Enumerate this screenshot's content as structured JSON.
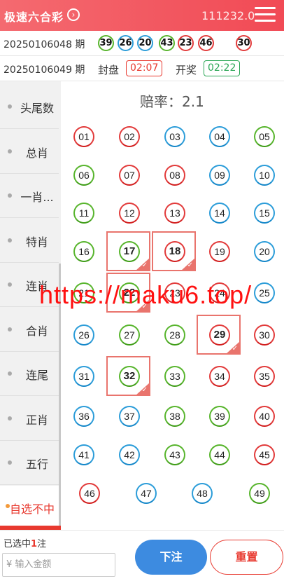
{
  "header": {
    "title": "极速六合彩",
    "balance": "111232.0"
  },
  "last_draw": {
    "period": "20250106048 期",
    "numbers": [
      {
        "n": "39",
        "color": "green"
      },
      {
        "n": "26",
        "color": "blue"
      },
      {
        "n": "20",
        "color": "blue"
      },
      {
        "n": "43",
        "color": "green"
      },
      {
        "n": "23",
        "color": "red"
      },
      {
        "n": "46",
        "color": "red"
      }
    ],
    "special": {
      "n": "30",
      "color": "red"
    }
  },
  "current": {
    "period": "20250106049 期",
    "close_label": "封盘",
    "close_time": "02:07",
    "open_label": "开奖",
    "open_time": "02:22"
  },
  "sidebar": {
    "items": [
      {
        "label": "头尾数"
      },
      {
        "label": "总肖"
      },
      {
        "label": "一肖..."
      },
      {
        "label": "特肖"
      },
      {
        "label": "连肖"
      },
      {
        "label": "合肖"
      },
      {
        "label": "连尾"
      },
      {
        "label": "正肖"
      },
      {
        "label": "五行"
      },
      {
        "label": "自选不中",
        "active": true
      }
    ]
  },
  "odds": "赔率：2.1",
  "balls": [
    {
      "n": "01",
      "c": "red"
    },
    {
      "n": "02",
      "c": "red"
    },
    {
      "n": "03",
      "c": "blue"
    },
    {
      "n": "04",
      "c": "blue"
    },
    {
      "n": "05",
      "c": "green"
    },
    {
      "n": "06",
      "c": "green"
    },
    {
      "n": "07",
      "c": "red"
    },
    {
      "n": "08",
      "c": "red"
    },
    {
      "n": "09",
      "c": "blue"
    },
    {
      "n": "10",
      "c": "blue"
    },
    {
      "n": "11",
      "c": "green"
    },
    {
      "n": "12",
      "c": "red"
    },
    {
      "n": "13",
      "c": "red"
    },
    {
      "n": "14",
      "c": "blue"
    },
    {
      "n": "15",
      "c": "blue"
    },
    {
      "n": "16",
      "c": "green"
    },
    {
      "n": "17",
      "c": "green",
      "sel": true
    },
    {
      "n": "18",
      "c": "red",
      "sel": true
    },
    {
      "n": "19",
      "c": "red"
    },
    {
      "n": "20",
      "c": "blue"
    },
    {
      "n": "21",
      "c": "green"
    },
    {
      "n": "22",
      "c": "green",
      "sel": true
    },
    {
      "n": "23",
      "c": "red"
    },
    {
      "n": "24",
      "c": "red"
    },
    {
      "n": "25",
      "c": "blue"
    },
    {
      "n": "26",
      "c": "blue"
    },
    {
      "n": "27",
      "c": "green"
    },
    {
      "n": "28",
      "c": "green"
    },
    {
      "n": "29",
      "c": "red",
      "sel": true
    },
    {
      "n": "30",
      "c": "red"
    },
    {
      "n": "31",
      "c": "blue"
    },
    {
      "n": "32",
      "c": "green",
      "sel": true
    },
    {
      "n": "33",
      "c": "green"
    },
    {
      "n": "34",
      "c": "red"
    },
    {
      "n": "35",
      "c": "red"
    },
    {
      "n": "36",
      "c": "blue"
    },
    {
      "n": "37",
      "c": "blue"
    },
    {
      "n": "38",
      "c": "green"
    },
    {
      "n": "39",
      "c": "green"
    },
    {
      "n": "40",
      "c": "red"
    },
    {
      "n": "41",
      "c": "blue"
    },
    {
      "n": "42",
      "c": "blue"
    },
    {
      "n": "43",
      "c": "green"
    },
    {
      "n": "44",
      "c": "green"
    },
    {
      "n": "45",
      "c": "red"
    },
    {
      "n": "46",
      "c": "red"
    },
    {
      "n": "47",
      "c": "blue"
    },
    {
      "n": "48",
      "c": "blue"
    },
    {
      "n": "49",
      "c": "green"
    }
  ],
  "watermark": "https://maku6.top/",
  "footer": {
    "chosen_prefix": "已选中",
    "chosen_count": "1",
    "chosen_suffix": "注",
    "amount_placeholder": "¥ 输入金额",
    "bet_label": "下注",
    "reset_label": "重置"
  },
  "colors": {
    "red": "#e23b3b",
    "blue": "#2c9dd9",
    "green": "#58b52d",
    "header": "#f14a55",
    "accent": "#e8392f"
  }
}
